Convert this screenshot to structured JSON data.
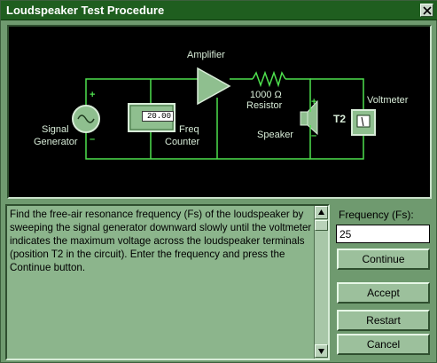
{
  "window": {
    "title": "Loudspeaker Test Procedure",
    "close_label": "X"
  },
  "circuit": {
    "labels": {
      "amplifier": "Amplifier",
      "resistor_value": "1000 Ω",
      "resistor": "Resistor",
      "voltmeter": "Voltmeter",
      "signal": "Signal",
      "generator": "Generator",
      "freq": "Freq",
      "counter": "Counter",
      "speaker": "Speaker",
      "t2": "T2",
      "plus": "+",
      "minus": "–"
    },
    "freq_counter_display": "20.00",
    "colors": {
      "wire": "#4ee04e",
      "component": "#8fbf8f"
    }
  },
  "instructions": {
    "text": "Find the free-air resonance frequency (Fs) of the loudspeaker by sweeping the signal generator downward slowly until the voltmeter indicates the maximum voltage across the loudspeaker terminals (position T2 in the circuit). Enter the frequency and press the Continue button."
  },
  "frequency": {
    "label": "Frequency (Fs):",
    "value": "25"
  },
  "buttons": {
    "continue": "Continue",
    "accept": "Accept",
    "restart": "Restart",
    "cancel": "Cancel"
  }
}
